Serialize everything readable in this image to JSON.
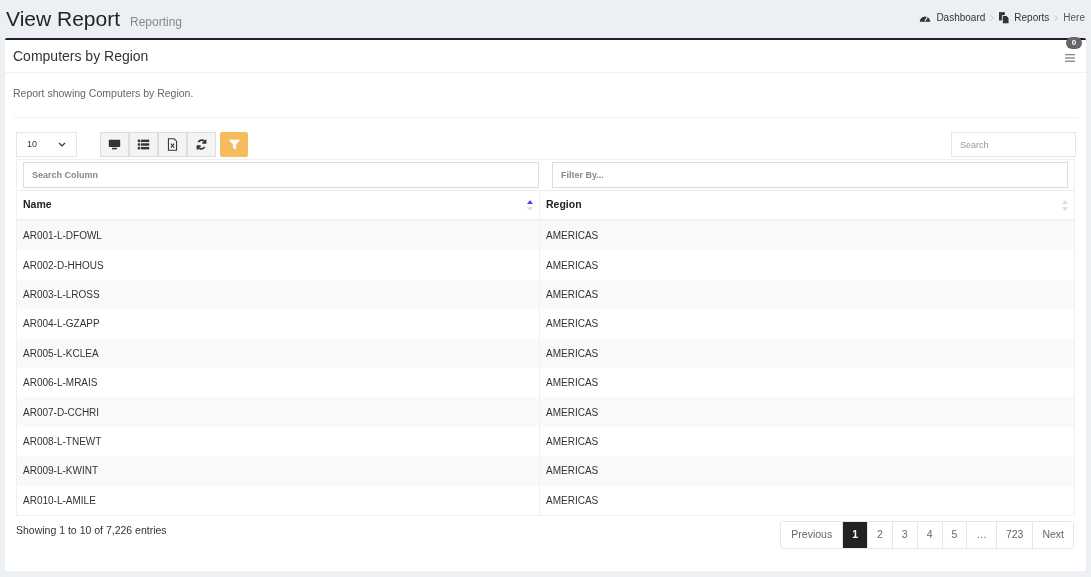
{
  "header": {
    "title": "View Report",
    "subtitle": "Reporting"
  },
  "breadcrumb": [
    {
      "label": "Dashboard",
      "kind": "dashboard"
    },
    {
      "label": "Reports",
      "kind": "reports"
    },
    {
      "label": "Here",
      "kind": "plain"
    }
  ],
  "card": {
    "title": "Computers by Region",
    "badge": "0",
    "description": "Report showing Computers by Region."
  },
  "page_size": "10",
  "toolbar": [
    {
      "kind": "monitor",
      "selected": false
    },
    {
      "kind": "list",
      "selected": false
    },
    {
      "kind": "excel",
      "selected": false
    },
    {
      "kind": "refresh",
      "selected": false
    },
    {
      "kind": "filter",
      "selected": true
    }
  ],
  "search": {
    "placeholder": "Search"
  },
  "column_filters": [
    {
      "placeholder": "Search Column"
    },
    {
      "placeholder": "Filter By..."
    }
  ],
  "table": {
    "columns": [
      {
        "label": "Name",
        "sorted_ascending": true
      },
      {
        "label": "Region",
        "sorted_ascending": false
      }
    ],
    "rows": [
      [
        "AR001-L-DFOWL",
        "AMERICAS"
      ],
      [
        "AR002-D-HHOUS",
        "AMERICAS"
      ],
      [
        "AR003-L-LROSS",
        "AMERICAS"
      ],
      [
        "AR004-L-GZAPP",
        "AMERICAS"
      ],
      [
        "AR005-L-KCLEA",
        "AMERICAS"
      ],
      [
        "AR006-L-MRAIS",
        "AMERICAS"
      ],
      [
        "AR007-D-CCHRI",
        "AMERICAS"
      ],
      [
        "AR008-L-TNEWT",
        "AMERICAS"
      ],
      [
        "AR009-L-KWINT",
        "AMERICAS"
      ],
      [
        "AR010-L-AMILE",
        "AMERICAS"
      ]
    ]
  },
  "info": "Showing 1 to 10 of 7,226 entries",
  "pagination": [
    {
      "label": "Previous",
      "selected": false
    },
    {
      "label": "1",
      "selected": true
    },
    {
      "label": "2",
      "selected": false
    },
    {
      "label": "3",
      "selected": false
    },
    {
      "label": "4",
      "selected": false
    },
    {
      "label": "5",
      "selected": false
    },
    {
      "label": "…",
      "selected": false
    },
    {
      "label": "723",
      "selected": false
    },
    {
      "label": "Next",
      "selected": false
    }
  ]
}
